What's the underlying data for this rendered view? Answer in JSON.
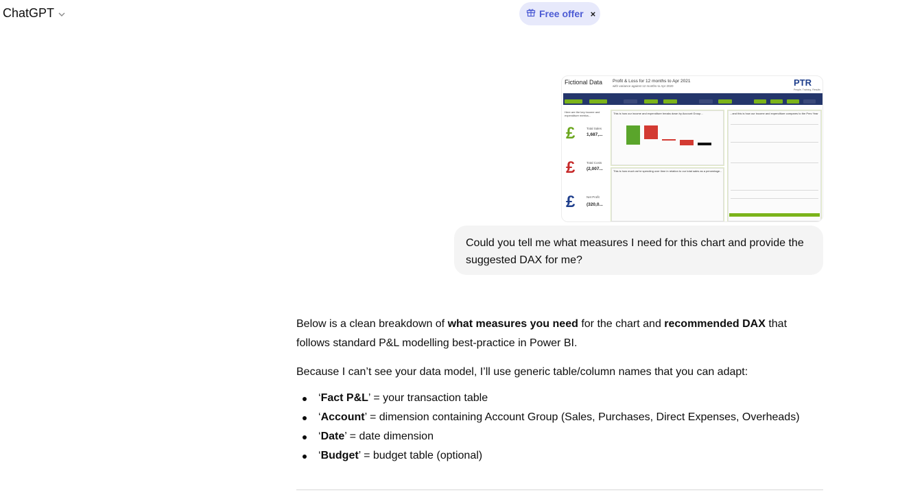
{
  "header": {
    "model_name": "ChatGPT",
    "offer_label": "Free offer",
    "offer_close": "×"
  },
  "attachment": {
    "title": "Fictional Data",
    "subtitle": "Profit & Loss for 12 months to Apr 2021",
    "subtitle2": "with variance against 12 months to Apr 2020",
    "logo": "PTR",
    "logo_sub": "People, Training, Results",
    "kpi_intro": "Here are the key income and expenditure metrics...",
    "kpis": [
      {
        "label": "Total Sales",
        "value": "1,687,...",
        "icon": "£",
        "color": "#6aa61c"
      },
      {
        "label": "Total Costs",
        "value": "(2,007...",
        "icon": "£",
        "color": "#c62828"
      },
      {
        "label": "Net Profit",
        "value": "(320,0...",
        "icon": "£",
        "color": "#1f3f8c"
      }
    ],
    "panel1_title": "This is how our income and expenditure breaks down by Account Group...",
    "panel2_title": "This is how much we're spending over time in relation to our total sales as a percentage...",
    "panel3_title": "...and this is how our income and expenditure compares to the Prev Year"
  },
  "user_message": {
    "text": "Could you tell me what measures I need for this chart and provide the suggested DAX for me?"
  },
  "assistant": {
    "p1_a": "Below is a clean breakdown of ",
    "p1_b": "what measures you need",
    "p1_c": " for the chart and ",
    "p1_d": "recommended DAX",
    "p1_e": " that follows standard P&L modelling best-practice in Power BI.",
    "p2": "Because I can’t see your data model, I’ll use generic table/column names that you can adapt:",
    "bullets": [
      {
        "name": "Fact P&L",
        "desc": " = your transaction table"
      },
      {
        "name": "Account",
        "desc": " = dimension containing Account Group (Sales, Purchases, Direct Expenses, Overheads)"
      },
      {
        "name": "Date",
        "desc": " = date dimension"
      },
      {
        "name": "Budget",
        "desc": " = budget table (optional)"
      }
    ]
  }
}
